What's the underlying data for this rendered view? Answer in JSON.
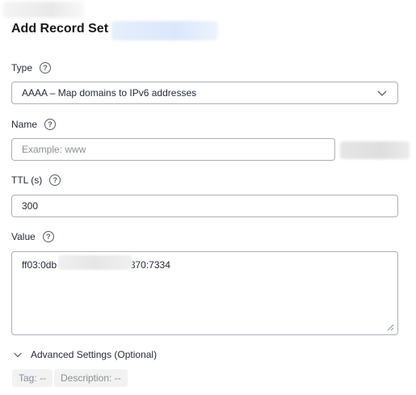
{
  "dialog": {
    "title": "Add Record Set"
  },
  "type_field": {
    "label": "Type",
    "help_glyph": "?",
    "value": "AAAA – Map domains to IPv6 addresses"
  },
  "name_field": {
    "label": "Name",
    "help_glyph": "?",
    "placeholder": "Example: www"
  },
  "ttl_field": {
    "label": "TTL (s)",
    "help_glyph": "?",
    "value": "300"
  },
  "value_field": {
    "label": "Value",
    "help_glyph": "?",
    "value_prefix": "ff03:0db",
    "value_suffix": "0370:7334"
  },
  "advanced": {
    "label": "Advanced Settings (Optional)"
  },
  "tags": {
    "tag": "Tag: --",
    "description": "Description: --"
  },
  "icons": {
    "help": "question-circle-icon",
    "select_arrow": "chevron-down-icon",
    "expand": "chevron-down-icon",
    "resize": "resize-handle-icon"
  }
}
